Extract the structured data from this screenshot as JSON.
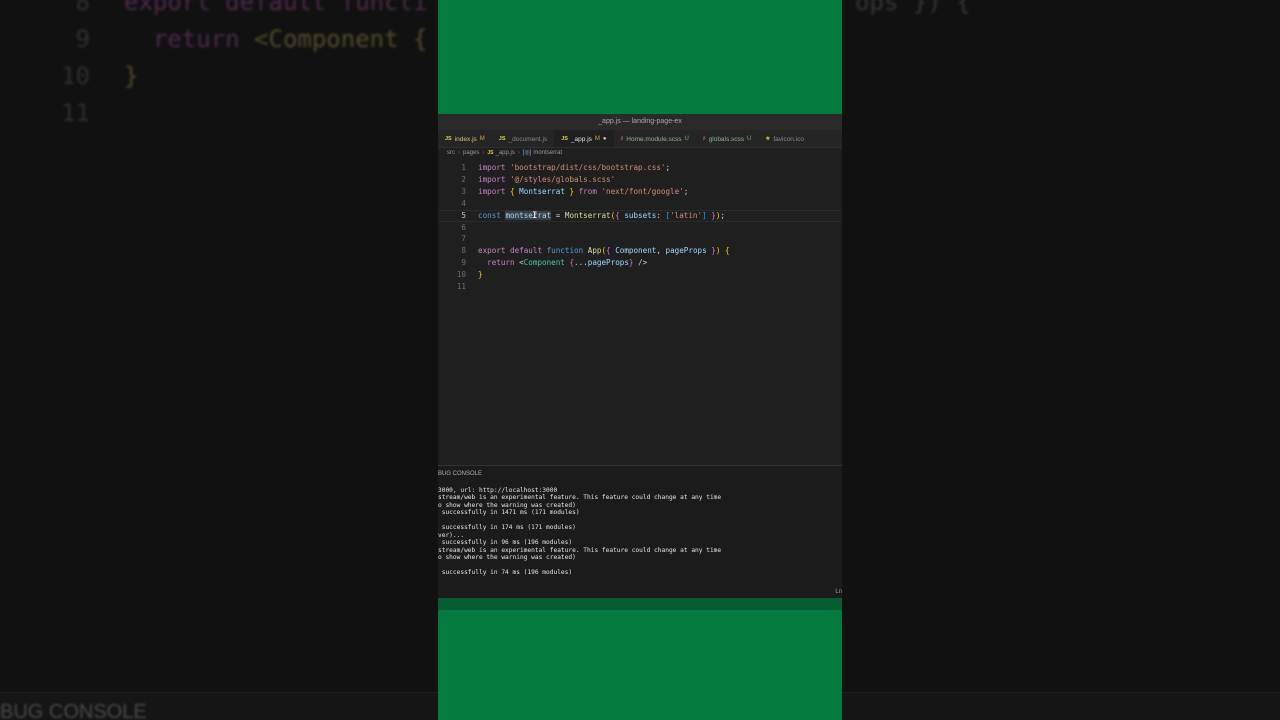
{
  "background": {
    "code_lines": [
      {
        "ln": "8",
        "parts": [
          {
            "t": "export default functi",
            "c": "kw"
          },
          {
            "t": "",
            "c": "plain"
          }
        ]
      },
      {
        "ln": "9",
        "parts": [
          {
            "t": "  return ",
            "c": "kw"
          },
          {
            "t": "<Component {",
            "c": "tag"
          }
        ]
      },
      {
        "ln": "10",
        "parts": [
          {
            "t": "}",
            "c": "tag"
          }
        ]
      },
      {
        "ln": "11",
        "parts": []
      }
    ],
    "right_code": "ops }) {",
    "bottom_label": "BUG CONSOLE"
  },
  "window": {
    "title": "_app.js — landing-page-ex",
    "tabs": [
      {
        "icon": "JS",
        "icon_type": "js",
        "label": "index.js",
        "mod": "M",
        "mod_type": "m",
        "active": false
      },
      {
        "icon": "JS",
        "icon_type": "js",
        "label": "_document.js",
        "mod": "",
        "mod_type": "",
        "active": false
      },
      {
        "icon": "JS",
        "icon_type": "js",
        "label": "_app.js",
        "mod": "M",
        "mod_type": "m",
        "dot": "●",
        "active": true
      },
      {
        "icon": "♯",
        "icon_type": "scss",
        "label": "Home.module.scss",
        "mod": "U",
        "mod_type": "u",
        "active": false
      },
      {
        "icon": "♯",
        "icon_type": "scss",
        "label": "globals.scss",
        "mod": "U",
        "mod_type": "u",
        "active": false
      },
      {
        "icon": "★",
        "icon_type": "star",
        "label": "favicon.ico",
        "mod": "",
        "mod_type": "",
        "active": false
      }
    ],
    "breadcrumb": {
      "src": "src",
      "pages": "pages",
      "file_icon": "JS",
      "file": "_app.js",
      "symbol_icon": "[◎]",
      "symbol": "montserrat"
    },
    "editor": {
      "current_line": 5,
      "lines": [
        {
          "ln": "1",
          "parts": [
            {
              "t": "import ",
              "c": "kw"
            },
            {
              "t": "'bootstrap/dist/css/bootstrap.css'",
              "c": "str"
            },
            {
              "t": ";",
              "c": "plain"
            }
          ]
        },
        {
          "ln": "2",
          "parts": [
            {
              "t": "import ",
              "c": "kw"
            },
            {
              "t": "'@/styles/globals.scss'",
              "c": "str"
            }
          ]
        },
        {
          "ln": "3",
          "parts": [
            {
              "t": "import ",
              "c": "kw"
            },
            {
              "t": "{ ",
              "c": "br"
            },
            {
              "t": "Montserrat",
              "c": "var"
            },
            {
              "t": " } ",
              "c": "br"
            },
            {
              "t": "from ",
              "c": "kw"
            },
            {
              "t": "'next/font/google'",
              "c": "str"
            },
            {
              "t": ";",
              "c": "plain"
            }
          ]
        },
        {
          "ln": "4",
          "parts": []
        },
        {
          "ln": "5",
          "parts": [
            {
              "t": "const ",
              "c": "kw2"
            },
            {
              "t": "montserrat",
              "c": "sel"
            },
            {
              "t": " = ",
              "c": "plain"
            },
            {
              "t": "Montserrat",
              "c": "fn"
            },
            {
              "t": "(",
              "c": "br"
            },
            {
              "t": "{ ",
              "c": "br2"
            },
            {
              "t": "subsets",
              "c": "prop"
            },
            {
              "t": ": ",
              "c": "plain"
            },
            {
              "t": "[",
              "c": "br3"
            },
            {
              "t": "'latin'",
              "c": "str"
            },
            {
              "t": "]",
              "c": "br3"
            },
            {
              "t": " }",
              "c": "br2"
            },
            {
              "t": ")",
              "c": "br"
            },
            {
              "t": ";",
              "c": "plain"
            }
          ]
        },
        {
          "ln": "6",
          "parts": []
        },
        {
          "ln": "7",
          "parts": []
        },
        {
          "ln": "8",
          "parts": [
            {
              "t": "export ",
              "c": "kw"
            },
            {
              "t": "default ",
              "c": "kw"
            },
            {
              "t": "function ",
              "c": "kw2"
            },
            {
              "t": "App",
              "c": "fn"
            },
            {
              "t": "(",
              "c": "br"
            },
            {
              "t": "{ ",
              "c": "br2"
            },
            {
              "t": "Component",
              "c": "var"
            },
            {
              "t": ", ",
              "c": "plain"
            },
            {
              "t": "pageProps",
              "c": "var"
            },
            {
              "t": " }",
              "c": "br2"
            },
            {
              "t": ") ",
              "c": "br"
            },
            {
              "t": "{",
              "c": "br"
            }
          ]
        },
        {
          "ln": "9",
          "parts": [
            {
              "t": "  return ",
              "c": "kw"
            },
            {
              "t": "<",
              "c": "plain"
            },
            {
              "t": "Component",
              "c": "tag"
            },
            {
              "t": " ",
              "c": "plain"
            },
            {
              "t": "{",
              "c": "br2"
            },
            {
              "t": "...",
              "c": "plain"
            },
            {
              "t": "pageProps",
              "c": "var"
            },
            {
              "t": "}",
              "c": "br2"
            },
            {
              "t": " />",
              "c": "plain"
            }
          ]
        },
        {
          "ln": "10",
          "parts": [
            {
              "t": "}",
              "c": "br"
            }
          ]
        },
        {
          "ln": "11",
          "parts": []
        }
      ]
    },
    "panel": {
      "header": "BUG CONSOLE",
      "terminal_lines": [
        "3000, url: http://localhost:3000",
        "stream/web is an experimental feature. This feature could change at any time",
        "o show where the warning was created)",
        " successfully in 1471 ms (171 modules)",
        "",
        " successfully in 174 ms (171 modules)",
        "ver)...",
        " successfully in 96 ms (196 modules)",
        "stream/web is an experimental feature. This feature could change at any time",
        "o show where the warning was created)",
        "",
        " successfully in 74 ms (196 modules)"
      ],
      "status_right": "Ln"
    }
  },
  "colors": {
    "green": "#047a3f",
    "editor_bg": "#1f1f1f"
  }
}
